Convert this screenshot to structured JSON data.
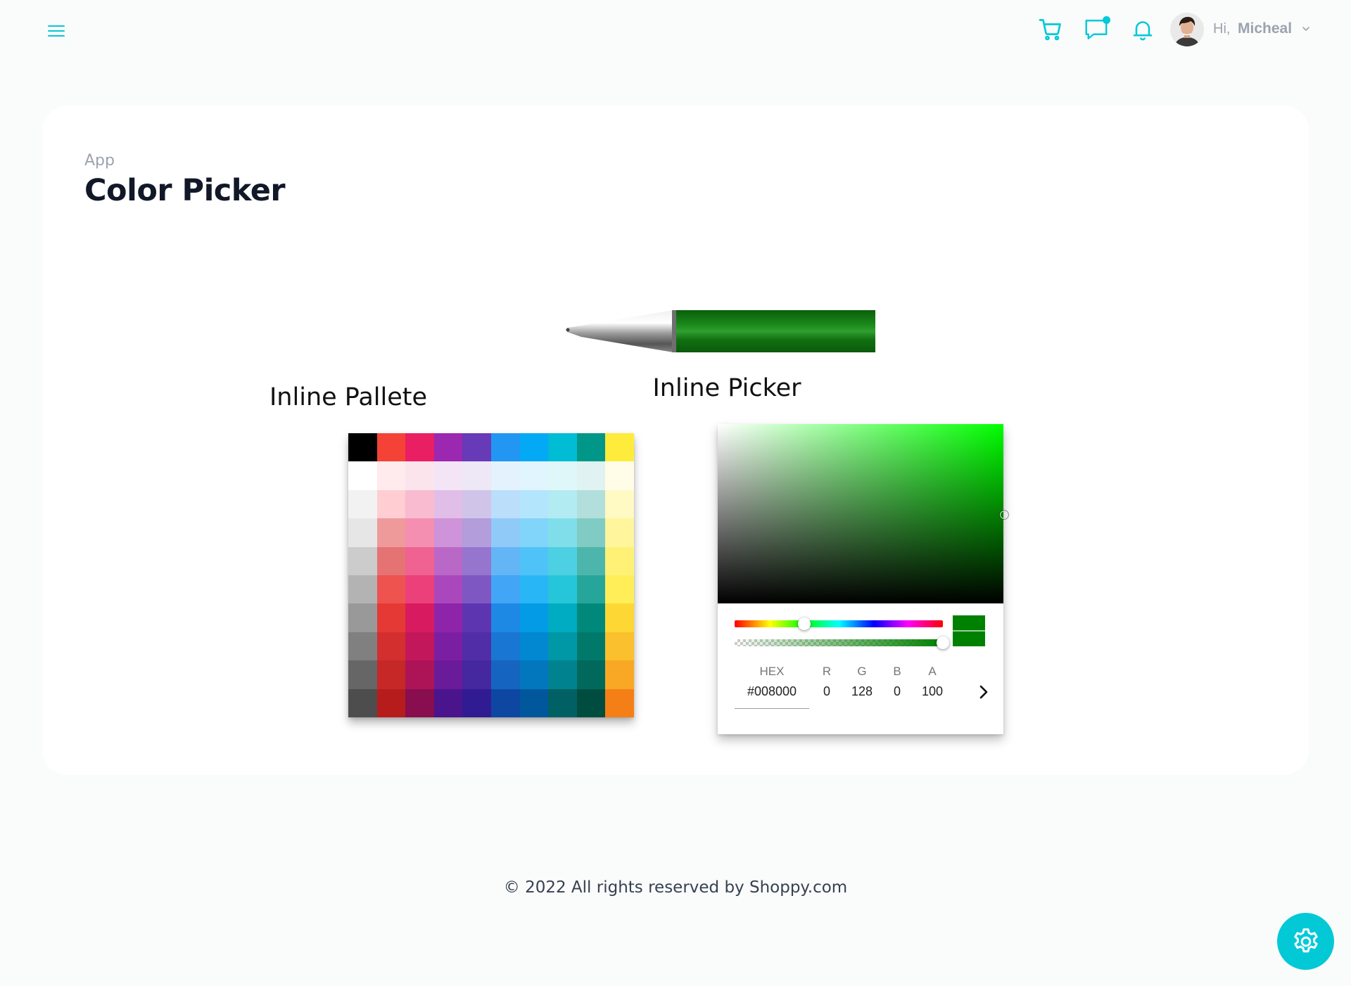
{
  "header": {
    "menu_icon": "hamburger-menu-icon",
    "icons": [
      "cart-icon",
      "chat-icon",
      "bell-icon"
    ],
    "greeting": "Hi,",
    "username": "Micheal",
    "accent": "#03c9d7"
  },
  "page": {
    "breadcrumb": "App",
    "title": "Color Picker"
  },
  "pen": {
    "color": "#008000"
  },
  "palette": {
    "title": "Inline Pallete",
    "rows": [
      [
        "#000000",
        "#f44336",
        "#e91e63",
        "#9c27b0",
        "#673ab7",
        "#2196f3",
        "#03a9f4",
        "#00bcd4",
        "#009688",
        "#ffeb3b"
      ],
      [
        "#ffffff",
        "#ffebee",
        "#fce4ec",
        "#f3e5f5",
        "#ede7f6",
        "#e3f2fd",
        "#e1f5fe",
        "#e0f7fa",
        "#e0f2f1",
        "#fffde7"
      ],
      [
        "#f2f2f2",
        "#ffcdd2",
        "#f8bbd0",
        "#e1bee7",
        "#d1c4e9",
        "#bbdefb",
        "#b3e5fc",
        "#b2ebf2",
        "#b2dfdb",
        "#fff9c4"
      ],
      [
        "#e6e6e6",
        "#ef9a9a",
        "#f48fb1",
        "#ce93d8",
        "#b39ddb",
        "#90caf9",
        "#81d4fa",
        "#80deea",
        "#80cbc4",
        "#fff59d"
      ],
      [
        "#cccccc",
        "#e57373",
        "#f06292",
        "#ba68c8",
        "#9575cd",
        "#64b5f6",
        "#4fc3f7",
        "#4dd0e1",
        "#4db6ac",
        "#fff176"
      ],
      [
        "#b3b3b3",
        "#ef5350",
        "#ec407a",
        "#ab47bc",
        "#7e57c2",
        "#42a5f5",
        "#29b6f6",
        "#26c6da",
        "#26a69a",
        "#ffee58"
      ],
      [
        "#999999",
        "#e53935",
        "#d81b60",
        "#8e24aa",
        "#5e35b1",
        "#1e88e5",
        "#039be5",
        "#00acc1",
        "#00897b",
        "#fdd835"
      ],
      [
        "#808080",
        "#d32f2f",
        "#c2185b",
        "#7b1fa2",
        "#512da8",
        "#1976d2",
        "#0288d1",
        "#0097a7",
        "#00796b",
        "#fbc02d"
      ],
      [
        "#666666",
        "#c62828",
        "#ad1457",
        "#6a1b9a",
        "#4527a0",
        "#1565c0",
        "#0277bd",
        "#00838f",
        "#00695c",
        "#f9a825"
      ],
      [
        "#4d4d4d",
        "#b71c1c",
        "#880e4f",
        "#4a148c",
        "#311b92",
        "#0d47a1",
        "#01579b",
        "#006064",
        "#004d40",
        "#f57f17"
      ]
    ]
  },
  "picker": {
    "title": "Inline Picker",
    "labels": {
      "hex": "HEX",
      "r": "R",
      "g": "G",
      "b": "B",
      "a": "A"
    },
    "values": {
      "hex": "#008000",
      "r": "0",
      "g": "128",
      "b": "0",
      "a": "100"
    },
    "hue_fraction": 0.333,
    "alpha_fraction": 1.0,
    "mode_icon": "chevron-right-icon"
  },
  "footer": {
    "text": "© 2022 All rights reserved by Shoppy.com"
  },
  "settings": {
    "icon": "gear-icon"
  }
}
